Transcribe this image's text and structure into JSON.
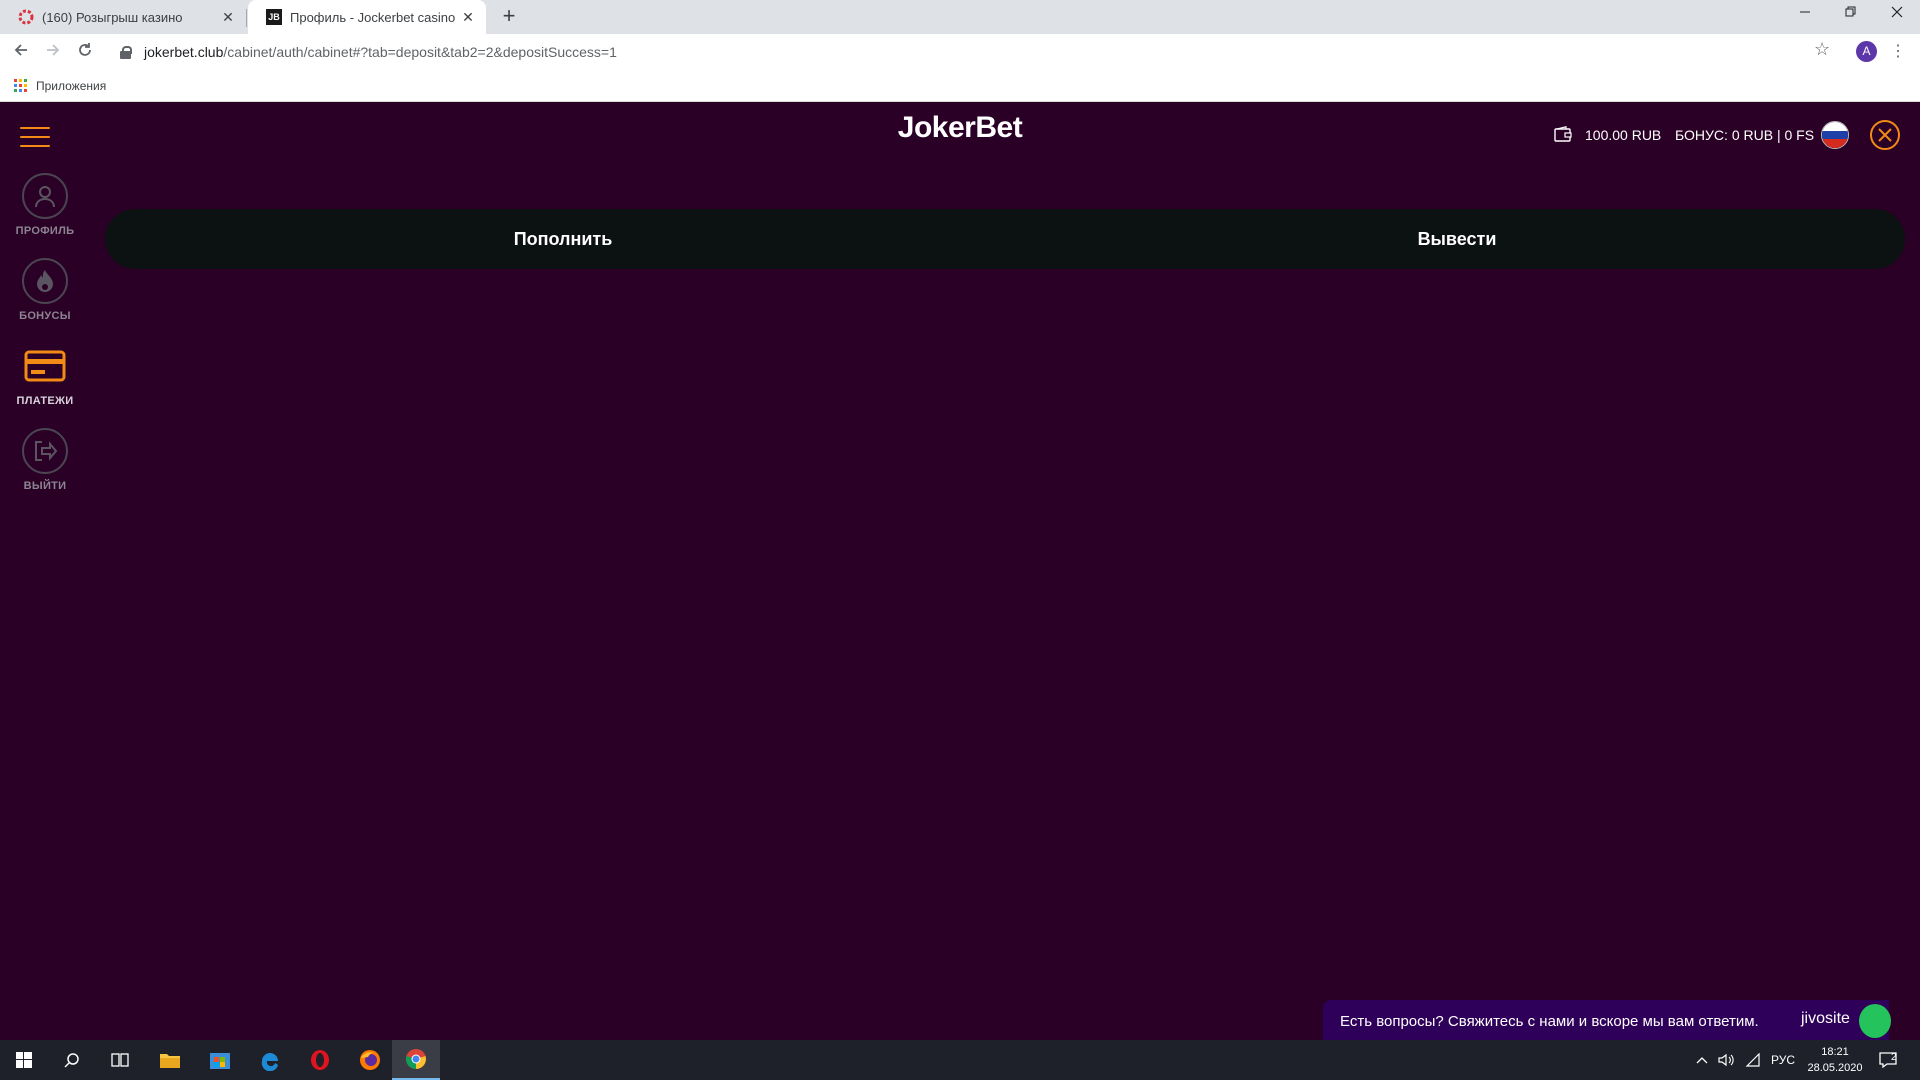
{
  "browser": {
    "tabs": [
      {
        "title": "(160) Розыгрыш казино",
        "active": false
      },
      {
        "title": "Профиль - Jockerbet casino",
        "active": true
      }
    ],
    "tab_close_glyph": "✕",
    "new_tab_glyph": "+",
    "favicon_text": "JB",
    "url_host": "jokerbet.club",
    "url_path": "/cabinet/auth/cabinet#?tab=deposit&tab2=2&depositSuccess=1",
    "profile_initial": "A",
    "bookmarks_apps_label": "Приложения"
  },
  "site": {
    "logo": "JokerBet",
    "balance": "100.00 RUB",
    "bonus": "БОНУС: 0 RUB | 0 FS",
    "accent_color": "#f28a16",
    "background_color": "#2a0026",
    "side_nav": [
      {
        "label": "ПРОФИЛЬ",
        "icon": "user-icon"
      },
      {
        "label": "БОНУСЫ",
        "icon": "flame-icon"
      },
      {
        "label": "ПЛАТЕЖИ",
        "icon": "card-icon",
        "active": true
      },
      {
        "label": "ВЫЙТИ",
        "icon": "logout-icon"
      }
    ],
    "tabs": [
      "Пополнить",
      "Вывести"
    ]
  },
  "chat": {
    "text": "Есть вопросы? Свяжитесь с нами и вскоре мы вам ответим.",
    "brand": "jivosite"
  },
  "taskbar": {
    "language": "РУС",
    "time": "18:21",
    "date": "28.05.2020",
    "notifications": "2"
  }
}
